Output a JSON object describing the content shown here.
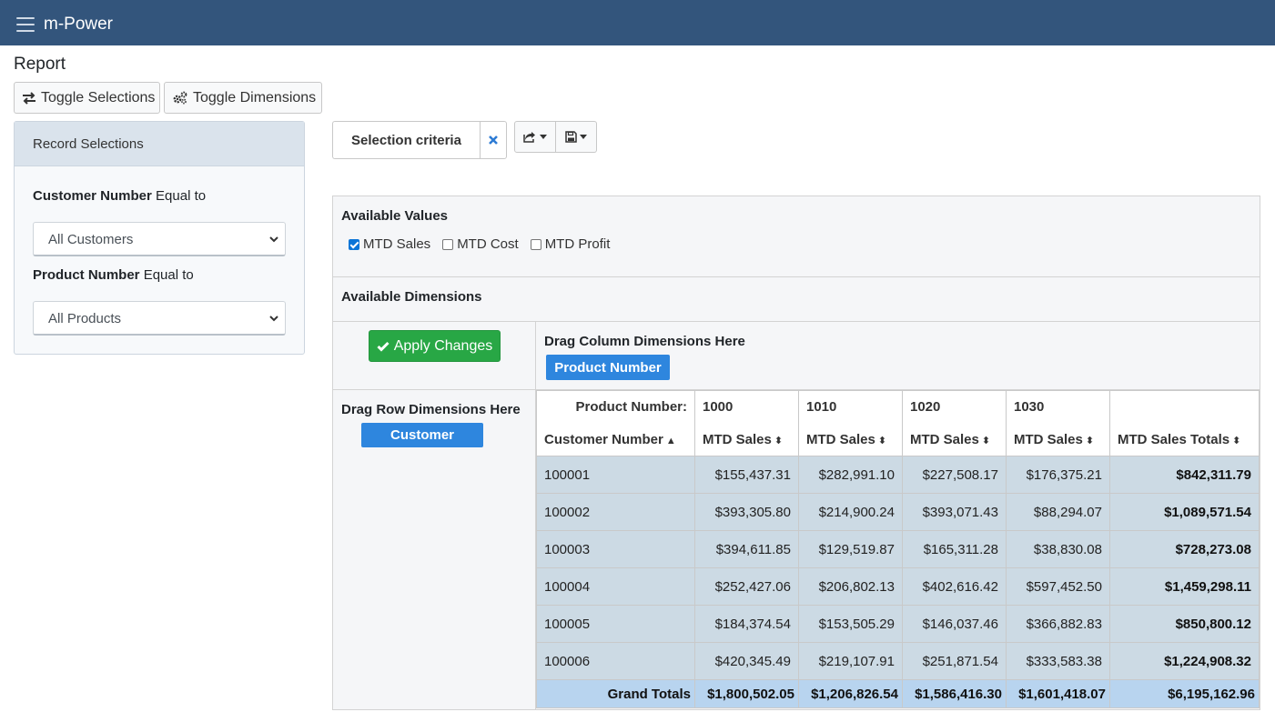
{
  "app": {
    "title": "m-Power"
  },
  "page": {
    "title": "Report"
  },
  "toolbar": {
    "toggle_selections": "Toggle Selections",
    "toggle_dimensions": "Toggle Dimensions"
  },
  "record_selections": {
    "title": "Record Selections",
    "fields": [
      {
        "name": "Customer Number",
        "operator": "Equal to",
        "value": "All Customers"
      },
      {
        "name": "Product Number",
        "operator": "Equal to",
        "value": "All Products"
      }
    ]
  },
  "criteria": {
    "label": "Selection criteria"
  },
  "pivot": {
    "available_values_title": "Available Values",
    "values": [
      {
        "label": "MTD Sales",
        "checked": true
      },
      {
        "label": "MTD Cost",
        "checked": false
      },
      {
        "label": "MTD Profit",
        "checked": false
      }
    ],
    "available_dimensions_title": "Available Dimensions",
    "apply_label": "Apply Changes",
    "column_drop_title": "Drag Column Dimensions Here",
    "column_dimension": "Product Number",
    "row_drop_title": "Drag Row Dimensions Here",
    "row_dimension": "Customer"
  },
  "table": {
    "product_label": "Product Number:",
    "row_header": "Customer Number",
    "products": [
      "1000",
      "1010",
      "1020",
      "1030"
    ],
    "measure": "MTD Sales",
    "totals_header": "MTD Sales Totals",
    "rows": [
      {
        "customer": "100001",
        "values": [
          "$155,437.31",
          "$282,991.10",
          "$227,508.17",
          "$176,375.21"
        ],
        "total": "$842,311.79"
      },
      {
        "customer": "100002",
        "values": [
          "$393,305.80",
          "$214,900.24",
          "$393,071.43",
          "$88,294.07"
        ],
        "total": "$1,089,571.54"
      },
      {
        "customer": "100003",
        "values": [
          "$394,611.85",
          "$129,519.87",
          "$165,311.28",
          "$38,830.08"
        ],
        "total": "$728,273.08"
      },
      {
        "customer": "100004",
        "values": [
          "$252,427.06",
          "$206,802.13",
          "$402,616.42",
          "$597,452.50"
        ],
        "total": "$1,459,298.11"
      },
      {
        "customer": "100005",
        "values": [
          "$184,374.54",
          "$153,505.29",
          "$146,037.46",
          "$366,882.83"
        ],
        "total": "$850,800.12"
      },
      {
        "customer": "100006",
        "values": [
          "$420,345.49",
          "$219,107.91",
          "$251,871.54",
          "$333,583.38"
        ],
        "total": "$1,224,908.32"
      }
    ],
    "grand_totals_label": "Grand Totals",
    "grand_totals": [
      "$1,800,502.05",
      "$1,206,826.54",
      "$1,586,416.30",
      "$1,601,418.07"
    ],
    "grand_total": "$6,195,162.96"
  },
  "icons": {
    "menu": "hamburger-icon",
    "toggle_selections": "exchange-arrows-icon",
    "toggle_dimensions": "gears-icon",
    "criteria_close": "close-icon",
    "export": "share-icon",
    "save": "floppy-disk-icon",
    "apply": "check-icon",
    "select_chevron": "chevron-down-icon"
  },
  "colors": {
    "navbar": "#33557c",
    "apply_button": "#28a745",
    "dimension_chip": "#2e86de",
    "data_cell": "#ccdae4",
    "grand_totals_row": "#b8d4ef"
  }
}
